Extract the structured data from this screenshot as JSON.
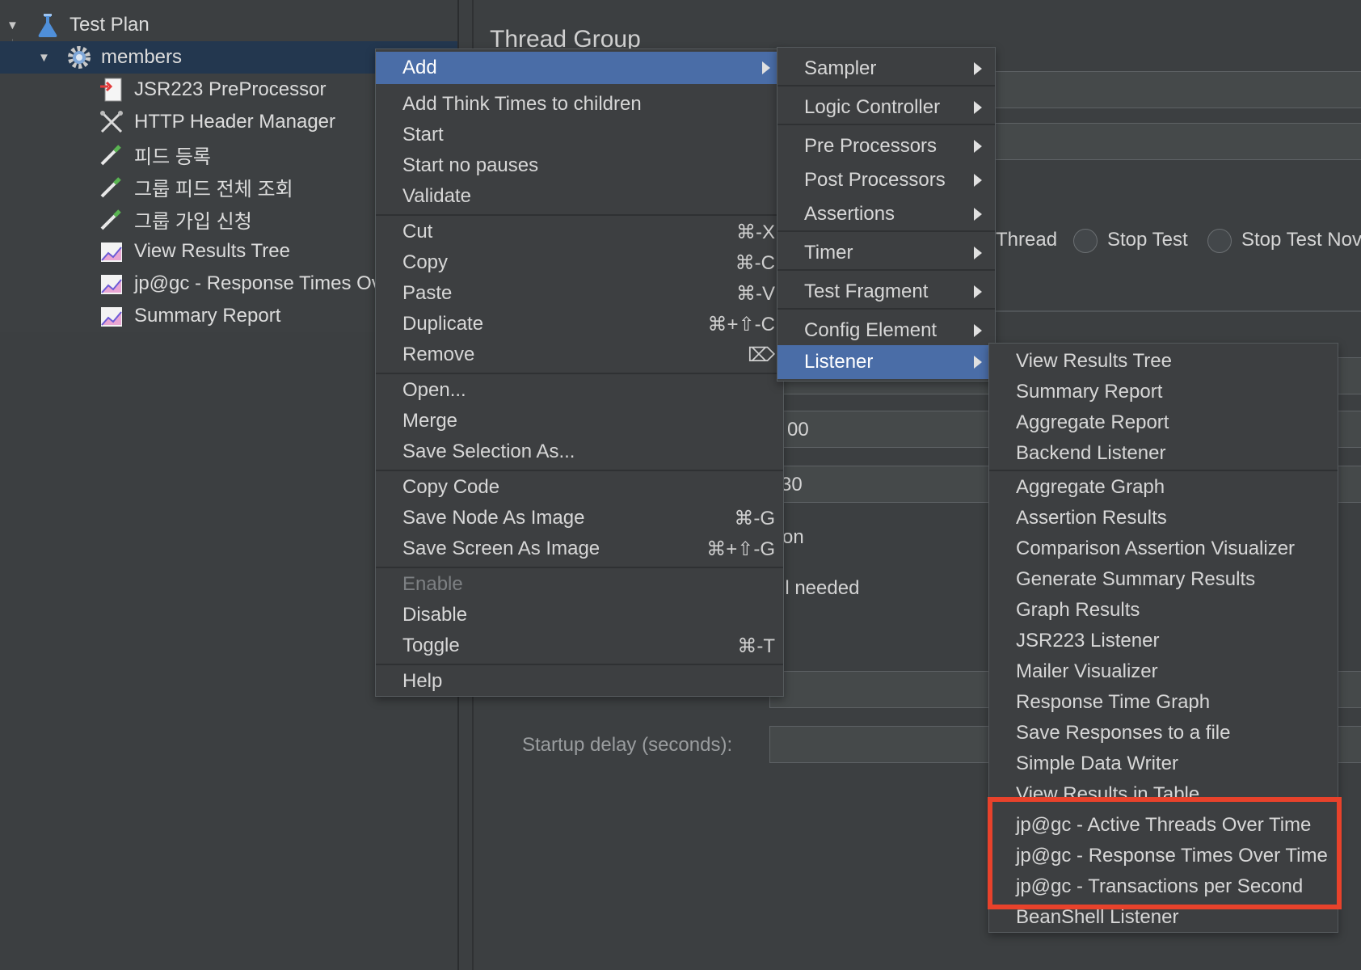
{
  "tree": {
    "items": [
      {
        "label": "Test Plan",
        "icon": "flask-icon"
      },
      {
        "label": "members",
        "icon": "gear-icon"
      },
      {
        "label": "JSR223 PreProcessor",
        "icon": "preprocessor-icon"
      },
      {
        "label": "HTTP Header Manager",
        "icon": "tools-icon"
      },
      {
        "label": "피드 등록",
        "icon": "pipette-icon"
      },
      {
        "label": "그룹 피드 전체 조회",
        "icon": "pipette-icon"
      },
      {
        "label": "그룹 가입 신청",
        "icon": "pipette-icon"
      },
      {
        "label": "View Results Tree",
        "icon": "graph-icon"
      },
      {
        "label": "jp@gc - Response Times Ov",
        "icon": "graph-icon"
      },
      {
        "label": "Summary Report",
        "icon": "graph-icon"
      }
    ]
  },
  "panel": {
    "title": "Thread Group",
    "radio_partial": "Thread",
    "radio_stop_test": "Stop Test",
    "radio_stop_test_now": "Stop Test Nov",
    "partial_field_1": "00",
    "partial_field_2": "30",
    "partial_text_1": "on",
    "partial_text_2": "il needed",
    "startup_delay_label": "Startup delay (seconds):"
  },
  "context_menu": {
    "add": "Add",
    "add_think_times": "Add Think Times to children",
    "start": "Start",
    "start_no_pauses": "Start no pauses",
    "validate": "Validate",
    "cut": "Cut",
    "cut_sc": "⌘-X",
    "copy": "Copy",
    "copy_sc": "⌘-C",
    "paste": "Paste",
    "paste_sc": "⌘-V",
    "duplicate": "Duplicate",
    "duplicate_sc": "⌘+⇧-C",
    "remove": "Remove",
    "remove_sc": "⌦",
    "open": "Open...",
    "merge": "Merge",
    "save_selection_as": "Save Selection As...",
    "copy_code": "Copy Code",
    "save_node_as_image": "Save Node As Image",
    "save_node_sc": "⌘-G",
    "save_screen_as_image": "Save Screen As Image",
    "save_screen_sc": "⌘+⇧-G",
    "enable": "Enable",
    "disable": "Disable",
    "toggle": "Toggle",
    "toggle_sc": "⌘-T",
    "help": "Help"
  },
  "add_submenu": [
    "Sampler",
    "Logic Controller",
    "Pre Processors",
    "Post Processors",
    "Assertions",
    "Timer",
    "Test Fragment",
    "Config Element",
    "Listener"
  ],
  "listener_submenu": [
    "View Results Tree",
    "Summary Report",
    "Aggregate Report",
    "Backend Listener",
    "Aggregate Graph",
    "Assertion Results",
    "Comparison Assertion Visualizer",
    "Generate Summary Results",
    "Graph Results",
    "JSR223 Listener",
    "Mailer Visualizer",
    "Response Time Graph",
    "Save Responses to a file",
    "Simple Data Writer",
    "View Results in Table",
    "jp@gc - Active Threads Over Time",
    "jp@gc - Response Times Over Time",
    "jp@gc - Transactions per Second",
    "BeanShell Listener"
  ],
  "colors": {
    "highlight": "#4a6da7",
    "annotation_box": "#e8422b",
    "background": "#3c3f41"
  }
}
